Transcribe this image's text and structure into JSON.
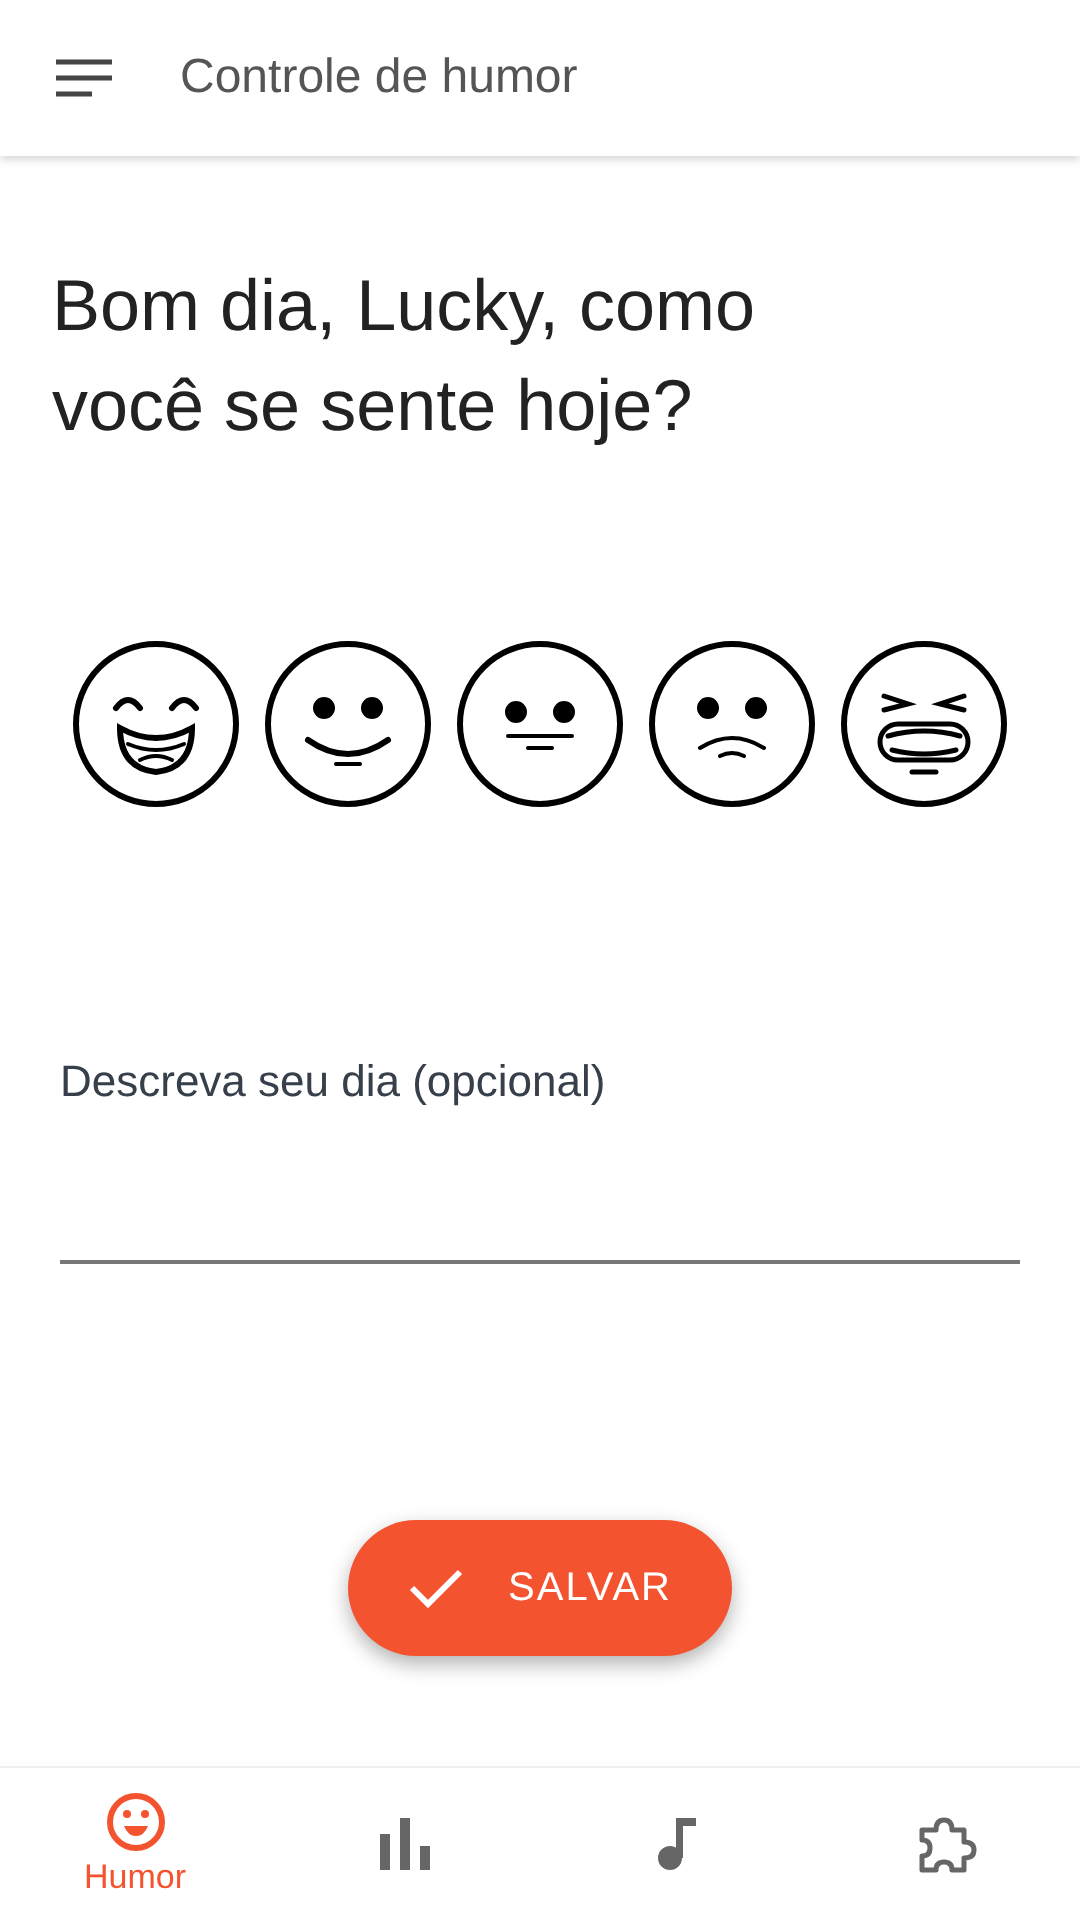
{
  "app_bar": {
    "title": "Controle de humor"
  },
  "greeting": "Bom dia, Lucky, como você se sente hoje?",
  "moods": [
    {
      "kind": "laughing"
    },
    {
      "kind": "smiling"
    },
    {
      "kind": "neutral"
    },
    {
      "kind": "sad"
    },
    {
      "kind": "crying"
    }
  ],
  "description_field": {
    "placeholder": "Descreva seu dia (opcional)"
  },
  "save_button": {
    "label": "SALVAR"
  },
  "bottom_nav": [
    {
      "kind": "mood",
      "label": "Humor",
      "selected": true
    },
    {
      "kind": "stats",
      "selected": false
    },
    {
      "kind": "music",
      "selected": false
    },
    {
      "kind": "extensions",
      "selected": false
    }
  ]
}
